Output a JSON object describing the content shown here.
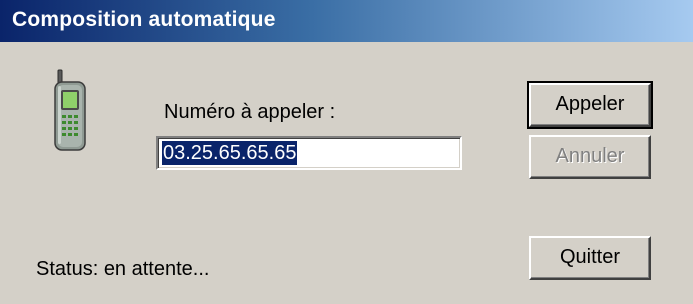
{
  "window": {
    "title": "Composition automatique"
  },
  "icons": {
    "phone": "mobile-phone-icon"
  },
  "form": {
    "number_label": "Numéro à appeler :",
    "number_value": "03.25.65.65.65"
  },
  "buttons": {
    "call_label": "Appeler",
    "cancel_label": "Annuler",
    "quit_label": "Quitter"
  },
  "status": {
    "text": "Status: en attente..."
  },
  "colors": {
    "face": "#d4d0c8",
    "title_start": "#0a246a",
    "title_end": "#a6caf0",
    "selection": "#0a246a",
    "disabled_text": "#808080"
  }
}
